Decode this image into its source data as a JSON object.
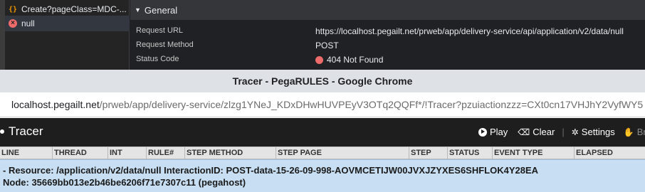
{
  "devtools": {
    "requests": [
      {
        "icon": "document-icon",
        "name": "Create?pageClass=MDC-..."
      },
      {
        "icon": "error-icon",
        "name": "null"
      }
    ],
    "general": {
      "header": "General",
      "rows": [
        {
          "label": "Request URL",
          "value": "https://localhost.pegailt.net/prweb/app/delivery-service/api/application/v2/data/null"
        },
        {
          "label": "Request Method",
          "value": "POST"
        },
        {
          "label": "Status Code",
          "value": "404 Not Found"
        }
      ]
    }
  },
  "window": {
    "title": "Tracer - PegaRULES - Google Chrome"
  },
  "address_bar": {
    "host": "localhost.pegailt.net",
    "path": "/prweb/app/delivery-service/zlzg1YNeJ_KDxDHwHUVPEyV3OTq2QQFf*/!Tracer?pzuiactionzzz=CXt0cn17VHJhY2VyfWY5"
  },
  "tracer": {
    "title": "Tracer",
    "toolbar": {
      "play": "Play",
      "clear": "Clear",
      "settings": "Settings",
      "break": "Break"
    },
    "columns": [
      "LINE",
      "THREAD",
      "INT",
      "RULE#",
      "STEP METHOD",
      "STEP PAGE",
      "STEP",
      "STATUS",
      "EVENT TYPE",
      "ELAPSED"
    ],
    "event": {
      "line1": "-  Resource: /application/v2/data/null InteractionID: POST-data-15-26-09-998-AOVMCETIJW00JVXJZYXES6SHFLOK4Y28EA",
      "line2": "Node: 35669bb013e2b46be6206f71e7307c11 (pegahost)"
    }
  },
  "colors": {
    "error": "#ee6b6b",
    "banner": "#c8dff3",
    "tracer_header": "#1e1e1e"
  }
}
